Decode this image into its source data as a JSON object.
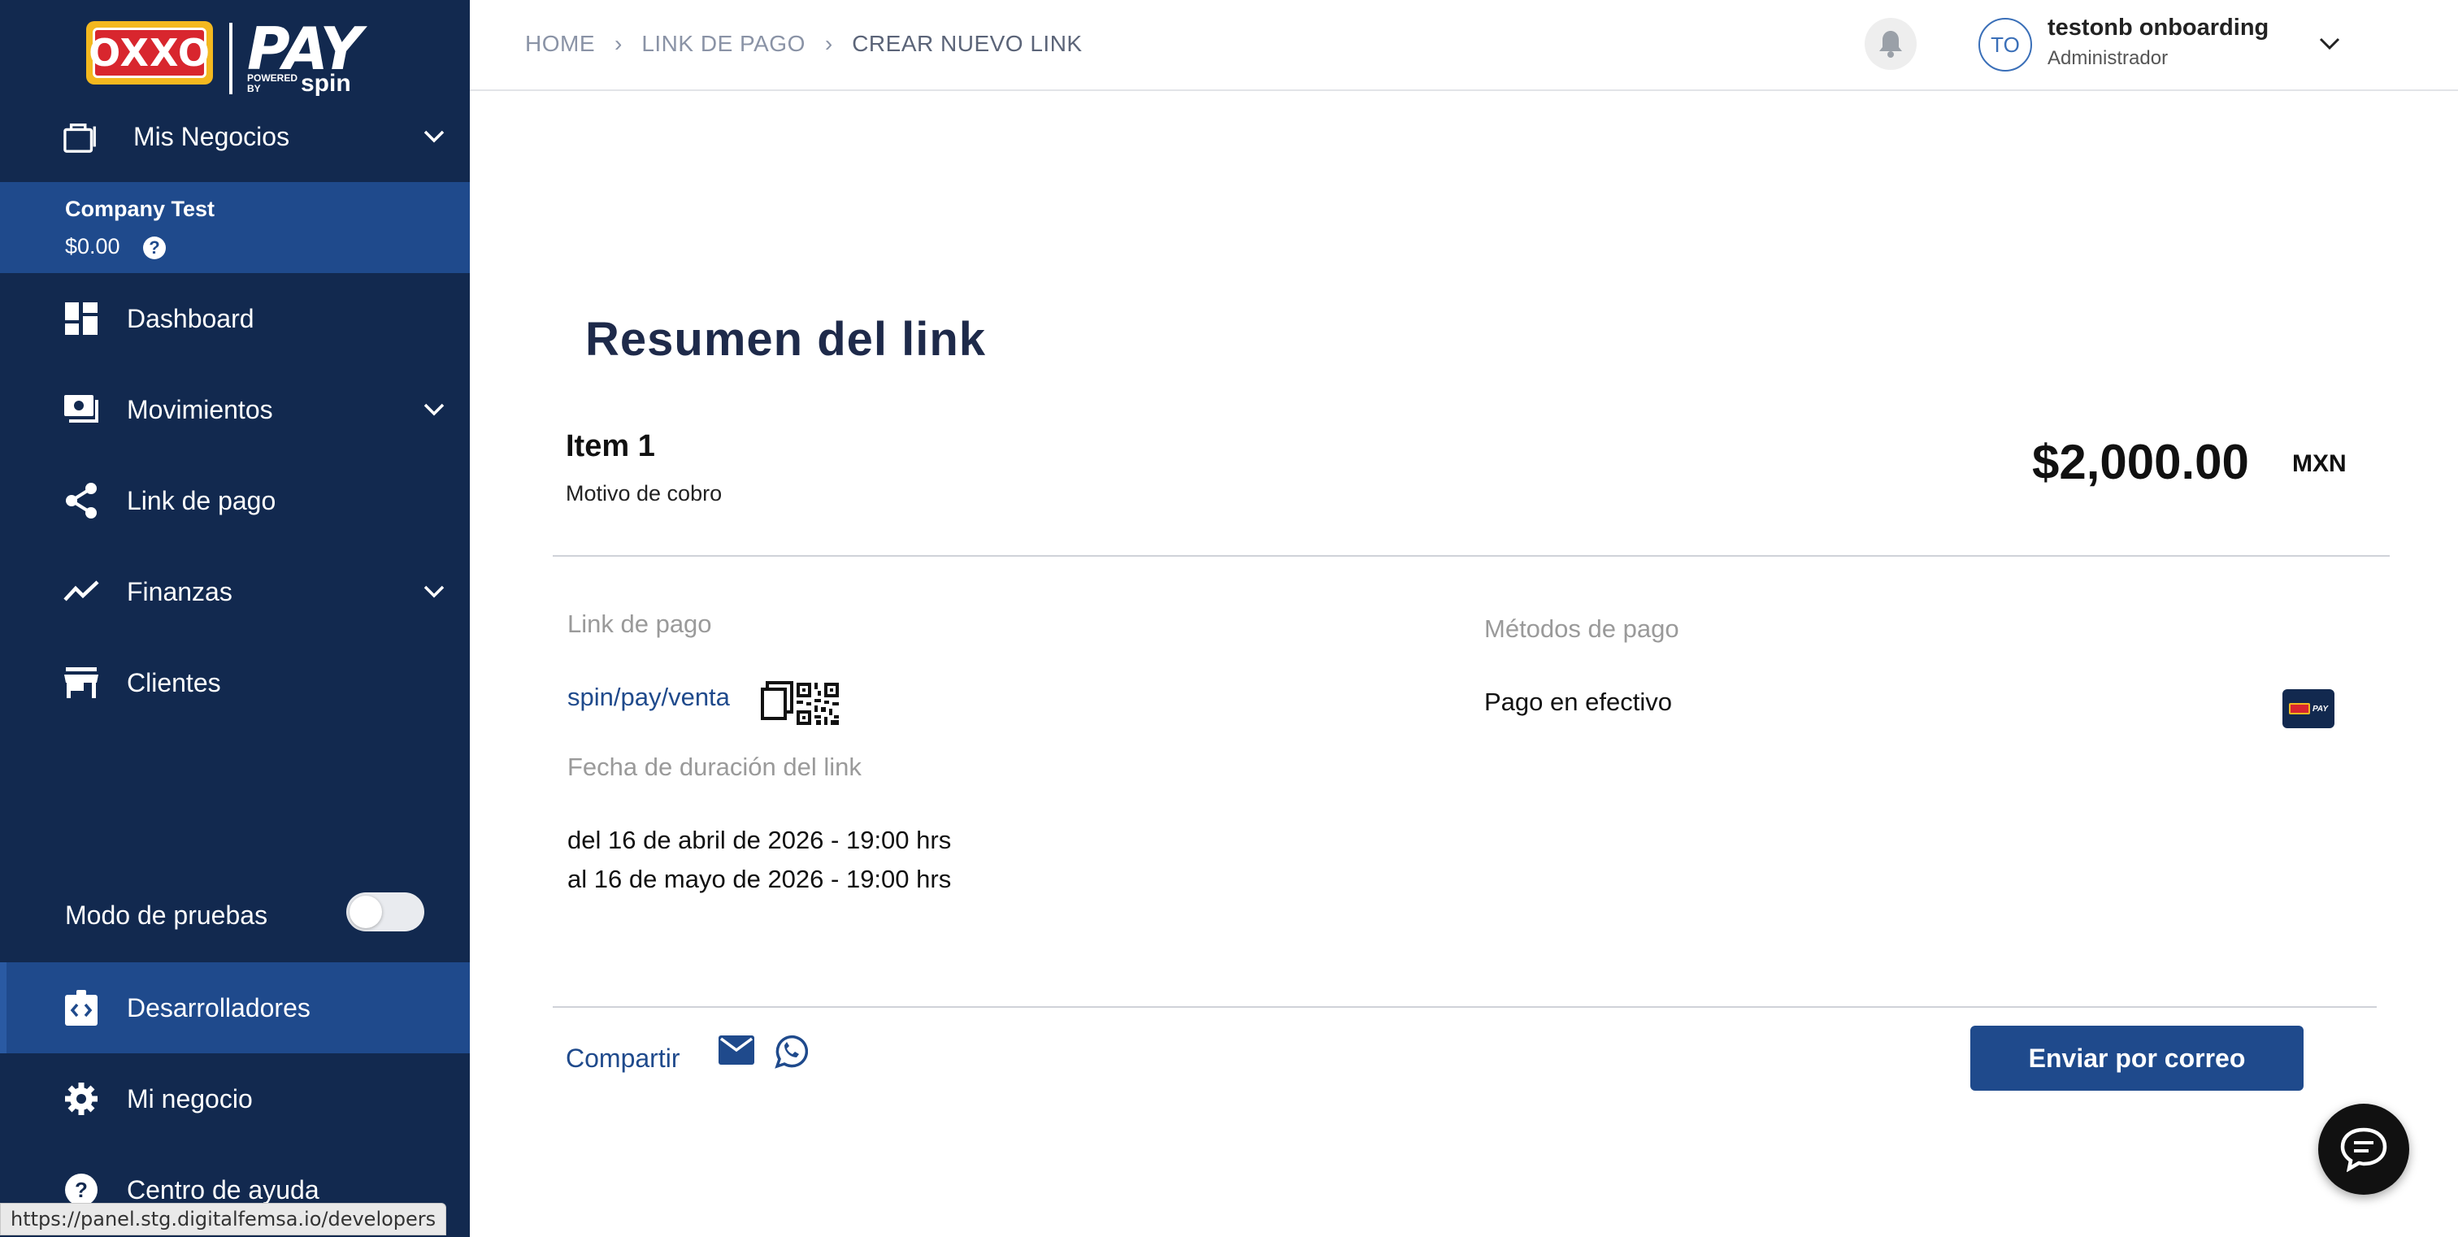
{
  "brand": {
    "logo_oxxo": "OXXO",
    "logo_pay": "PAY",
    "logo_powered": "POWERED BY",
    "logo_spin": "spin"
  },
  "sidebar": {
    "business_menu": "Mis Negocios",
    "company": {
      "name": "Company Test",
      "balance": "$0.00"
    },
    "items": [
      {
        "label": "Dashboard",
        "icon": "dashboard-icon"
      },
      {
        "label": "Movimientos",
        "icon": "cash-icon"
      },
      {
        "label": "Link de pago",
        "icon": "share-icon"
      },
      {
        "label": "Finanzas",
        "icon": "trending-icon"
      },
      {
        "label": "Clientes",
        "icon": "store-icon"
      }
    ],
    "test_mode": {
      "label": "Modo de pruebas",
      "enabled": false
    },
    "bottom_items": [
      {
        "label": "Desarrolladores",
        "icon": "developer-icon",
        "active": true
      },
      {
        "label": "Mi negocio",
        "icon": "gear-icon"
      },
      {
        "label": "Centro de ayuda",
        "icon": "help-icon"
      }
    ]
  },
  "status_url": "https://panel.stg.digitalfemsa.io/developers",
  "header": {
    "breadcrumbs": [
      "HOME",
      "LINK DE PAGO",
      "CREAR NUEVO LINK"
    ],
    "user": {
      "initials": "TO",
      "name": "testonb onboarding",
      "role": "Administrador"
    }
  },
  "summary": {
    "title": "Resumen del link",
    "item_name": "Item 1",
    "item_reason": "Motivo de cobro",
    "amount": "$2,000.00",
    "currency": "MXN",
    "link_label": "Link de pago",
    "link_url": "spin/pay/venta",
    "duration_label": "Fecha de duración del link",
    "date_from": "del 16 de abril de 2026 - 19:00 hrs",
    "date_to": "al 16 de mayo de 2026 - 19:00 hrs",
    "methods_label": "Métodos de pago",
    "method_name": "Pago en efectivo",
    "method_logo_text": "PAY",
    "share_label": "Compartir",
    "send_button": "Enviar por correo"
  },
  "colors": {
    "sidebar_bg": "#12294f",
    "sidebar_active": "#1f4a8c",
    "primary": "#1f4a8c",
    "title": "#1e2a4a"
  }
}
